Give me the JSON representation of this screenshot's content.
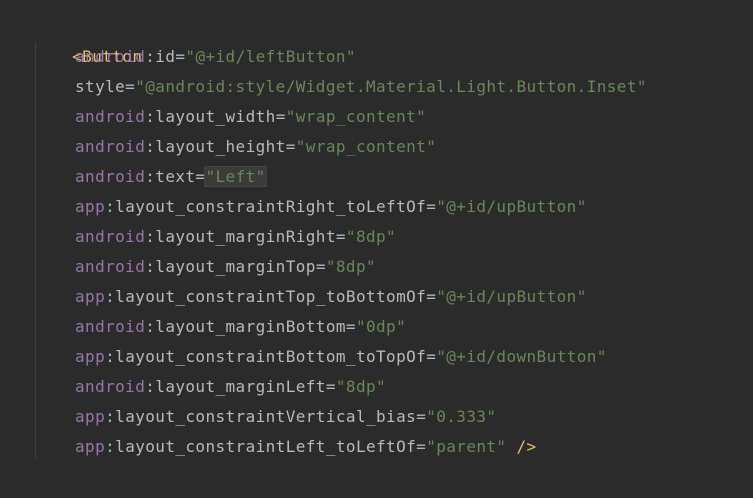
{
  "editor": {
    "lines": [
      {
        "tag": "<Button"
      },
      {
        "ns": "android",
        "attr": "id",
        "eq": "=",
        "val": "\"@+id/leftButton\""
      },
      {
        "ns": "",
        "attr": "style",
        "eq": "=",
        "val": "\"@android:style/Widget.Material.Light.Button.Inset\""
      },
      {
        "ns": "android",
        "attr": "layout_width",
        "eq": "=",
        "val": "\"wrap_content\""
      },
      {
        "ns": "android",
        "attr": "layout_height",
        "eq": "=",
        "val": "\"wrap_content\""
      },
      {
        "ns": "android",
        "attr": "text",
        "eq": "=",
        "val": "\"Left\""
      },
      {
        "ns": "app",
        "attr": "layout_constraintRight_toLeftOf",
        "eq": "=",
        "val": "\"@+id/upButton\""
      },
      {
        "ns": "android",
        "attr": "layout_marginRight",
        "eq": "=",
        "val": "\"8dp\""
      },
      {
        "ns": "android",
        "attr": "layout_marginTop",
        "eq": "=",
        "val": "\"8dp\""
      },
      {
        "ns": "app",
        "attr": "layout_constraintTop_toBottomOf",
        "eq": "=",
        "val": "\"@+id/upButton\""
      },
      {
        "ns": "android",
        "attr": "layout_marginBottom",
        "eq": "=",
        "val": "\"0dp\""
      },
      {
        "ns": "app",
        "attr": "layout_constraintBottom_toTopOf",
        "eq": "=",
        "val": "\"@+id/downButton\""
      },
      {
        "ns": "android",
        "attr": "layout_marginLeft",
        "eq": "=",
        "val": "\"8dp\""
      },
      {
        "ns": "app",
        "attr": "layout_constraintVertical_bias",
        "eq": "=",
        "val": "\"0.333\""
      },
      {
        "ns": "app",
        "attr": "layout_constraintLeft_toLeftOf",
        "eq": "=",
        "val": "\"parent\"",
        "close": " />"
      }
    ]
  },
  "colors": {
    "background": "#2b2b2b",
    "tag": "#e8bf6a",
    "namespace": "#9876aa",
    "attribute": "#bababa",
    "value": "#6a8759"
  }
}
